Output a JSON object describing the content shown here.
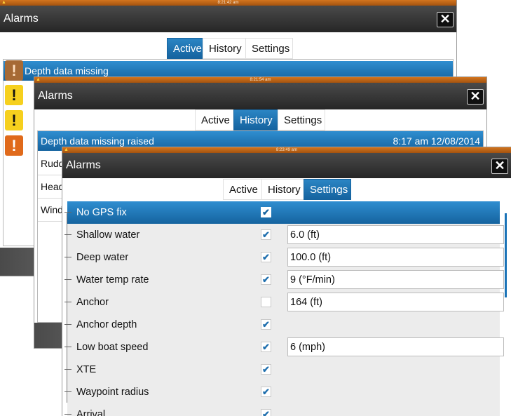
{
  "colors": {
    "accent": "#1a73b7",
    "statusbar": "#c7691a",
    "titlebar": "#2f2f2f",
    "alarm_orange": "#e06a1b",
    "alarm_yellow": "#f6d01e"
  },
  "window1": {
    "clock": "8:21:42 am",
    "title": "Alarms",
    "close_icon": "close-icon",
    "tabs": [
      "Active",
      "History",
      "Settings"
    ],
    "active_tab": "Active",
    "selected_alarm": "Depth data missing",
    "alarm_icons": [
      "bell-alarm-icon",
      "warning-icon",
      "warning-icon",
      "alarm-icon"
    ]
  },
  "window2": {
    "clock": "8:21:54 am",
    "title": "Alarms",
    "tabs": [
      "Active",
      "History",
      "Settings"
    ],
    "active_tab": "History",
    "rows": [
      {
        "text": "Depth data missing raised",
        "time": "8:17 am 12/08/2014"
      },
      {
        "text": "Rudd"
      },
      {
        "text": "Headi"
      },
      {
        "text": "Wind"
      }
    ]
  },
  "window3": {
    "clock": "8:23:49 am",
    "title": "Alarms",
    "tabs": [
      "Active",
      "History",
      "Settings"
    ],
    "active_tab": "Settings",
    "settings": [
      {
        "label": "No GPS fix",
        "checked": true,
        "value": ""
      },
      {
        "label": "Shallow water",
        "checked": true,
        "value": "6.0 (ft)"
      },
      {
        "label": "Deep water",
        "checked": true,
        "value": "100.0 (ft)"
      },
      {
        "label": "Water temp rate",
        "checked": true,
        "value": "9 (°F/min)"
      },
      {
        "label": "Anchor",
        "checked": false,
        "value": "164 (ft)"
      },
      {
        "label": "Anchor depth",
        "checked": true,
        "value": ""
      },
      {
        "label": "Low boat speed",
        "checked": true,
        "value": "6 (mph)"
      },
      {
        "label": "XTE",
        "checked": true,
        "value": ""
      },
      {
        "label": "Waypoint radius",
        "checked": true,
        "value": ""
      },
      {
        "label": "Arrival",
        "checked": true,
        "value": ""
      }
    ]
  }
}
